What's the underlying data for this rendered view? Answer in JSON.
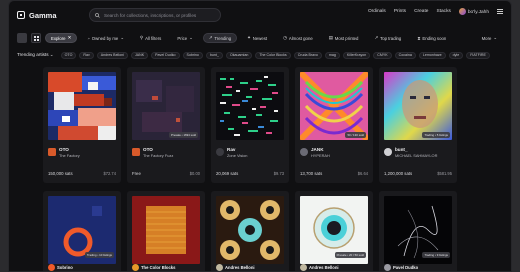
{
  "topbar": {
    "brand": "Gamma",
    "search_placeholder": "Search for collections, inscriptions, or profiles",
    "nav": [
      "Ordinals",
      "Prints",
      "Create",
      "Stacks"
    ],
    "user": "bo'ly.Jahh"
  },
  "filters": {
    "explore": "Explore",
    "owned": "Owned by me",
    "all_filters": "All filters",
    "price": "Price",
    "sorts": [
      "Trending",
      "Newest",
      "Almost gone",
      "Most printed",
      "Top trading",
      "Ending soon"
    ],
    "active_sort": "Trending",
    "more": "More"
  },
  "artists": {
    "label": "Trending artists",
    "chips": [
      "OTO",
      "Rav",
      "Andres Belloni",
      "JANK",
      "Pavel Dudko",
      "Sobrino",
      "bunt_",
      "Okauamian",
      "The Color Blocks",
      "Cruda Bravo",
      "mag",
      "KillerKrayon",
      "CMYK",
      "Cocaina",
      "Lemonhaze",
      "dyle",
      "FIATFIRE"
    ]
  },
  "cards_row1": [
    {
      "title": "OTO",
      "subtitle": "The Factory",
      "stat": "150,000 sats",
      "price": "$72.74",
      "badge": ""
    },
    {
      "title": "OTO",
      "subtitle": "The Factory Fuzz",
      "stat": "Free",
      "price": "$0.00",
      "badge": "Presale • 1694 sold"
    },
    {
      "title": "Rav",
      "subtitle": "Zone Vision",
      "stat": "20,069 sats",
      "price": "$9.73",
      "badge": ""
    },
    {
      "title": "JANK",
      "subtitle": "HYPERAH",
      "stat": "13,700 sats",
      "price": "$6.64",
      "badge": "50 / 130 sold"
    },
    {
      "title": "bunt_",
      "subtitle": "MICHAEL SAHMAYLOR",
      "stat": "1,200,000 sats",
      "price": "$581.95",
      "badge": "Trading • 5 listings"
    }
  ],
  "cards_row2": [
    {
      "title": "Sobrino",
      "badge": "Trading • 10 listings"
    },
    {
      "title": "The Color Blocks",
      "badge": ""
    },
    {
      "title": "Andres Belloni",
      "badge": ""
    },
    {
      "title": "Andres Belloni",
      "badge": "Presale • 20 / 50 sold"
    },
    {
      "title": "Pavel Dudko",
      "badge": "Trading • 9 listings"
    }
  ]
}
